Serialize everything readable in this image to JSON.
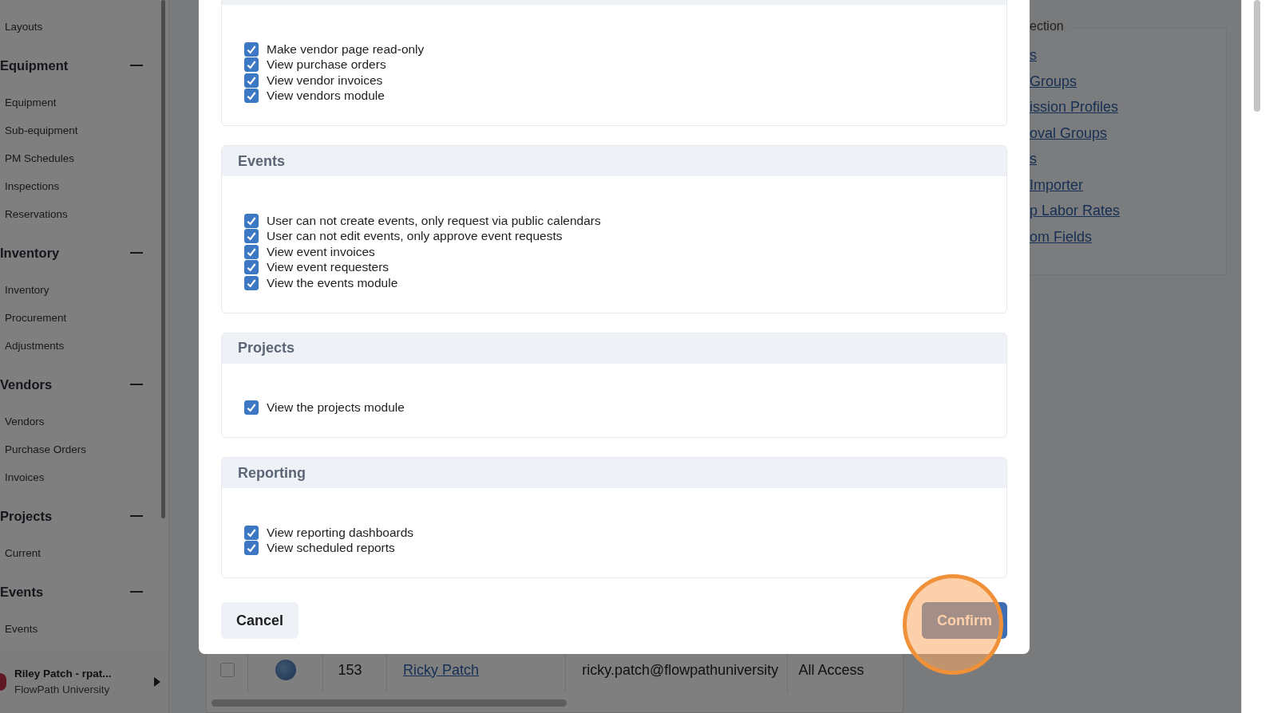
{
  "sidebar": {
    "top_items": [
      "Layouts"
    ],
    "groups": [
      {
        "title": "Equipment",
        "expanded": true,
        "items": [
          "Equipment",
          "Sub-equipment",
          "PM Schedules",
          "Inspections",
          "Reservations"
        ]
      },
      {
        "title": "Inventory",
        "expanded": true,
        "items": [
          "Inventory",
          "Procurement",
          "Adjustments"
        ]
      },
      {
        "title": "Vendors",
        "expanded": true,
        "items": [
          "Vendors",
          "Purchase Orders",
          "Invoices"
        ]
      },
      {
        "title": "Projects",
        "expanded": true,
        "items": [
          "Current"
        ]
      },
      {
        "title": "Events",
        "expanded": true,
        "items": [
          "Events"
        ]
      }
    ],
    "user": {
      "name": "Riley Patch - rpat...",
      "organization": "FlowPath University"
    }
  },
  "table_row": {
    "checked": false,
    "id": "153",
    "name": "Ricky Patch",
    "email": "ricky.patch@flowpathuniversity",
    "access": "All Access"
  },
  "right_panel": {
    "label": "ection",
    "links": [
      "s",
      "Groups",
      "ission Profiles",
      "oval Groups",
      "s",
      "Importer",
      "p Labor Rates",
      "om Fields"
    ]
  },
  "modal": {
    "sections": [
      {
        "options": [
          {
            "label": "Make vendor page read-only",
            "checked": true
          },
          {
            "label": "View purchase orders",
            "checked": true
          },
          {
            "label": "View vendor invoices",
            "checked": true
          },
          {
            "label": "View vendors module",
            "checked": true
          }
        ]
      },
      {
        "title": "Events",
        "options": [
          {
            "label": "User can not create events, only request via public calendars",
            "checked": true
          },
          {
            "label": "User can not edit events, only approve event requests",
            "checked": true
          },
          {
            "label": "View event invoices",
            "checked": true
          },
          {
            "label": "View event requesters",
            "checked": true
          },
          {
            "label": "View the events module",
            "checked": true
          }
        ]
      },
      {
        "title": "Projects",
        "options": [
          {
            "label": "View the projects module",
            "checked": true
          }
        ]
      },
      {
        "title": "Reporting",
        "options": [
          {
            "label": "View reporting dashboards",
            "checked": true
          },
          {
            "label": "View scheduled reports",
            "checked": true
          }
        ]
      }
    ],
    "cancel": "Cancel",
    "confirm": "Confirm"
  }
}
